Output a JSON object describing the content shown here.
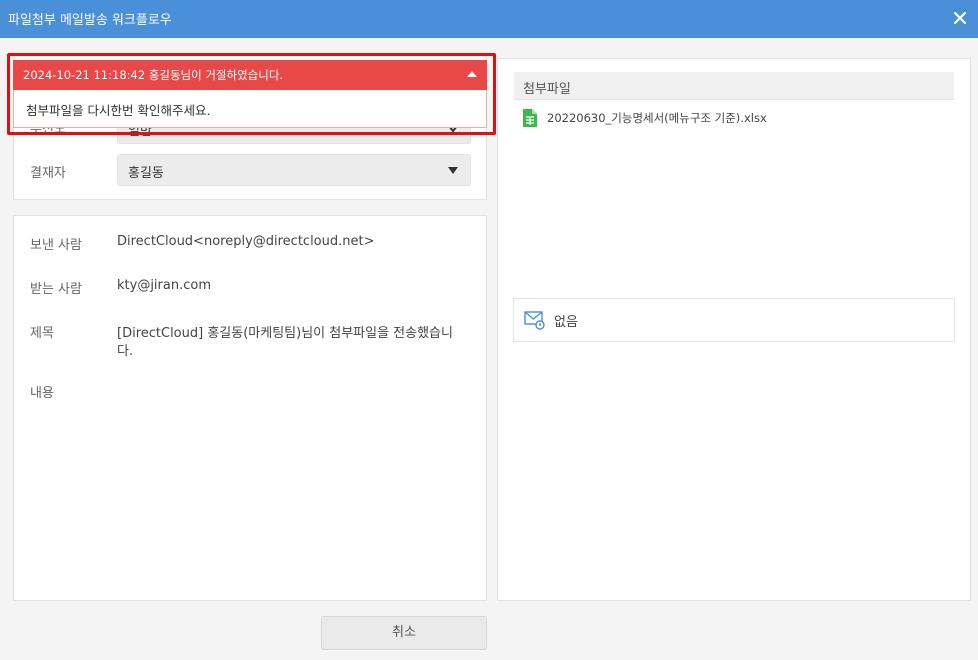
{
  "window": {
    "title": "파일첨부 메일발송 워크플로우",
    "close_icon": "close-icon"
  },
  "approval": {
    "priority_label": "우선도",
    "priority_value": "일반",
    "approver_label": "결재자",
    "approver_value": "홍길동"
  },
  "mail": {
    "sender_label": "보낸 사람",
    "sender_value": "DirectCloud<noreply@directcloud.net>",
    "recipient_label": "받는 사람",
    "recipient_value": "kty@jiran.com",
    "subject_label": "제목",
    "subject_line1": "[DirectCloud] 홍길동(마케팅팀)님이 첨부파일을 전송했습니",
    "subject_line2": "다.",
    "content_label": "내용"
  },
  "attachments": {
    "header": "첨부파일",
    "files": [
      {
        "name": "20220630_기능명세서(메뉴구조 기준).xlsx",
        "icon": "spreadsheet-file-icon"
      }
    ],
    "mail_attachment_value": "없음",
    "mail_icon": "mail-lock-icon"
  },
  "alert": {
    "title": "2024-10-21 11:18:42 홍길동님이 거절하였습니다.",
    "message": "첨부파일을 다시한번 확인해주세요.",
    "colors": {
      "header": "#e84848",
      "outline": "#e01010"
    }
  },
  "footer": {
    "cancel_label": "취소"
  },
  "colors": {
    "titlebar": "#4a90d9",
    "background": "#f4f4f4"
  }
}
